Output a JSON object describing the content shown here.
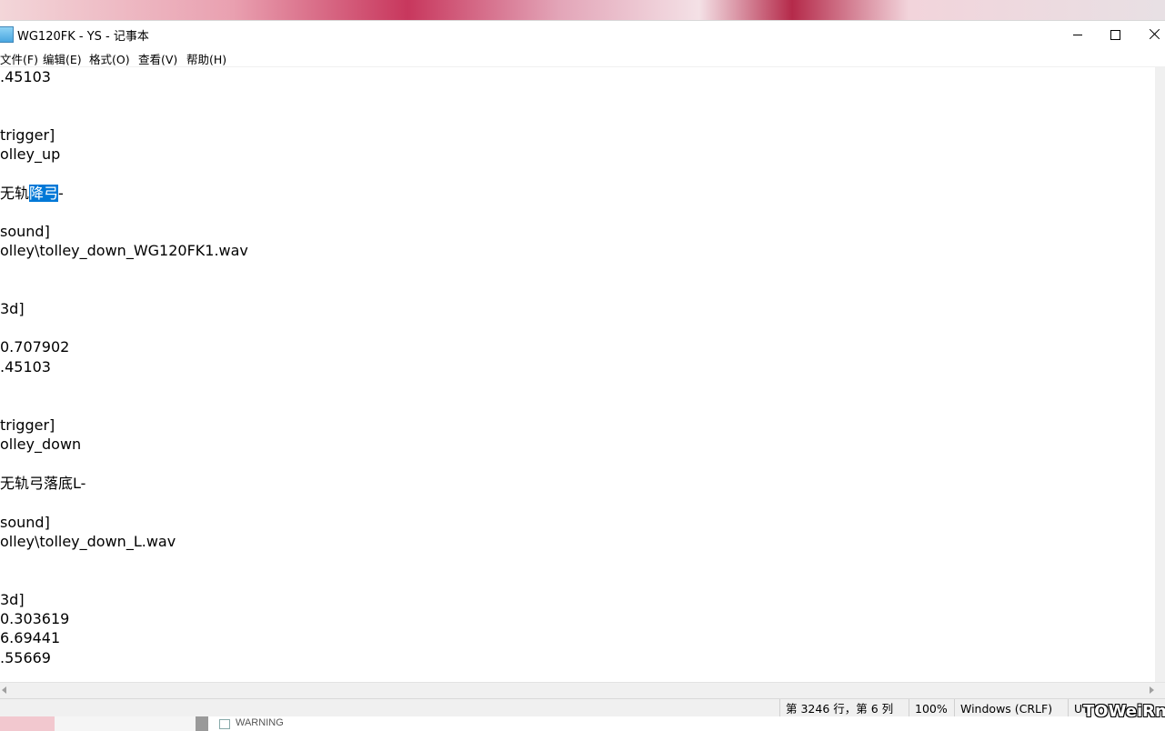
{
  "window": {
    "title": "WG120FK - YS - 记事本"
  },
  "menu": {
    "file": "文件(F)",
    "edit": "编辑(E)",
    "format": "格式(O)",
    "view": "查看(V)",
    "help": "帮助(H)"
  },
  "editor": {
    "lines": [
      ".45103",
      "",
      "",
      "trigger]",
      "olley_up",
      "",
      "无轨",
      "",
      "sound]",
      "olley\\tolley_down_WG120FK1.wav",
      "",
      "",
      "3d]",
      "",
      "0.707902",
      ".45103",
      "",
      "",
      "trigger]",
      "olley_down",
      "",
      "无轨弓落底L-",
      "",
      "sound]",
      "olley\\tolley_down_L.wav",
      "",
      "",
      "3d]",
      "0.303619",
      "6.69441",
      ".55669",
      ""
    ],
    "selected_text": "降弓",
    "after_selection": "-"
  },
  "status": {
    "position": "第 3246 行，第 6 列",
    "zoom": "100%",
    "line_ending": "Windows (CRLF)",
    "encoding": "UT"
  },
  "desktop": {
    "bottom_text": "WARNING"
  },
  "watermark": "TOWeiRne"
}
